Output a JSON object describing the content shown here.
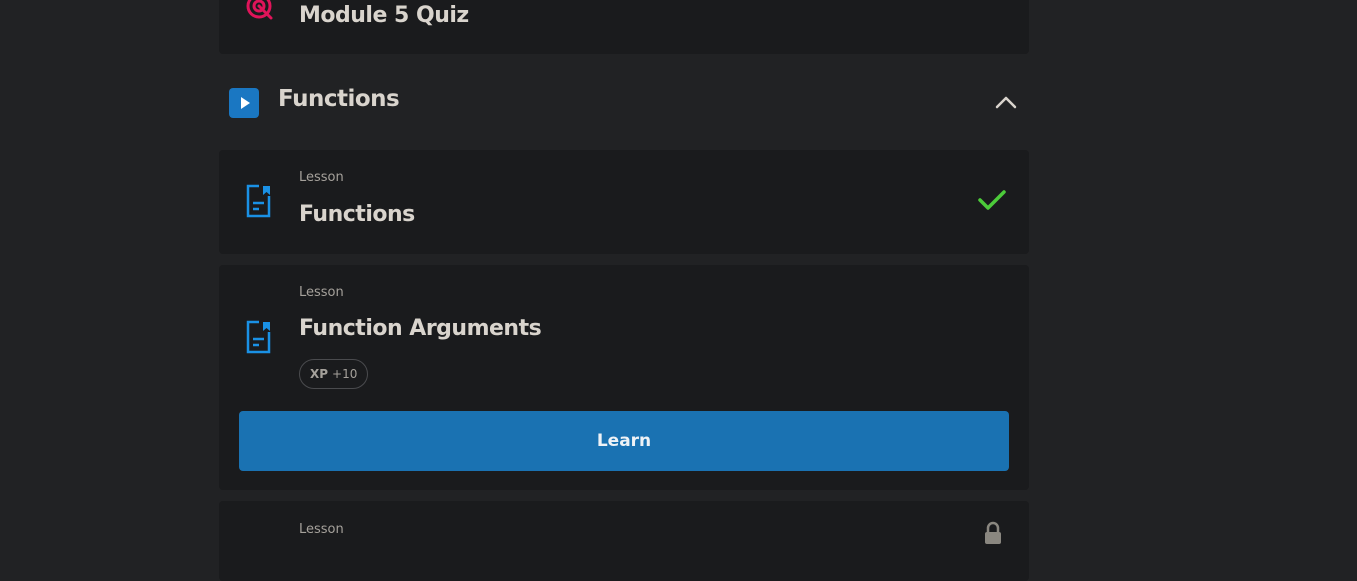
{
  "quiz_card": {
    "title": "Module 5 Quiz",
    "icon": "target-icon",
    "icon_color": "#e0145a"
  },
  "section": {
    "title": "Functions",
    "icon": "play-icon",
    "toggle_icon": "chevron-up-icon",
    "accent": "#1a77c2"
  },
  "lessons": [
    {
      "kind": "Lesson",
      "title": "Functions",
      "icon": "lesson-document-icon",
      "status_icon": "check-icon",
      "status_color": "#4ccb3a"
    },
    {
      "kind": "Lesson",
      "title": "Function Arguments",
      "icon": "lesson-document-icon",
      "xp_label": "XP",
      "xp_value": "+10",
      "button_label": "Learn"
    },
    {
      "kind": "Lesson",
      "status_icon": "lock-icon"
    }
  ],
  "colors": {
    "page_bg": "#212224",
    "card_bg": "#1a1b1d",
    "primary_button": "#1a72b2",
    "lesson_icon": "#1a91e5"
  }
}
